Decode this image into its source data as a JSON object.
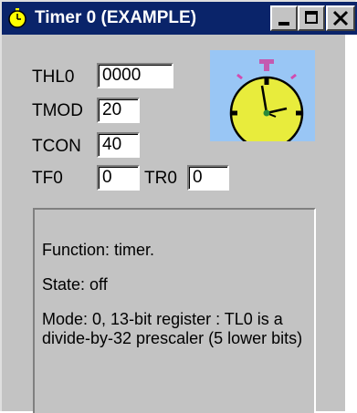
{
  "window": {
    "title": "Timer 0 (EXAMPLE)",
    "icon": "stopwatch-icon"
  },
  "titlebar_buttons": {
    "minimize": "minimize-icon",
    "maximize": "maximize-icon",
    "close": "close-icon"
  },
  "registers": [
    {
      "label": "THL0",
      "value": "0000"
    },
    {
      "label": "TMOD",
      "value": "20"
    },
    {
      "label": "TCON",
      "value": "40"
    }
  ],
  "flags": [
    {
      "label": "TF0",
      "value": "0"
    },
    {
      "label": "TR0",
      "value": "0"
    }
  ],
  "clock": {
    "icon": "stopwatch-icon",
    "face_color": "#e8ec3c",
    "background_color": "#99c6f5"
  },
  "info": {
    "function": "Function: timer.",
    "state": "State: off",
    "mode": "Mode: 0, 13-bit register : TL0 is a divide-by-32 prescaler (5 lower bits)"
  },
  "colors": {
    "titlebar": "#0a246a",
    "window": "#c3c3c3"
  }
}
